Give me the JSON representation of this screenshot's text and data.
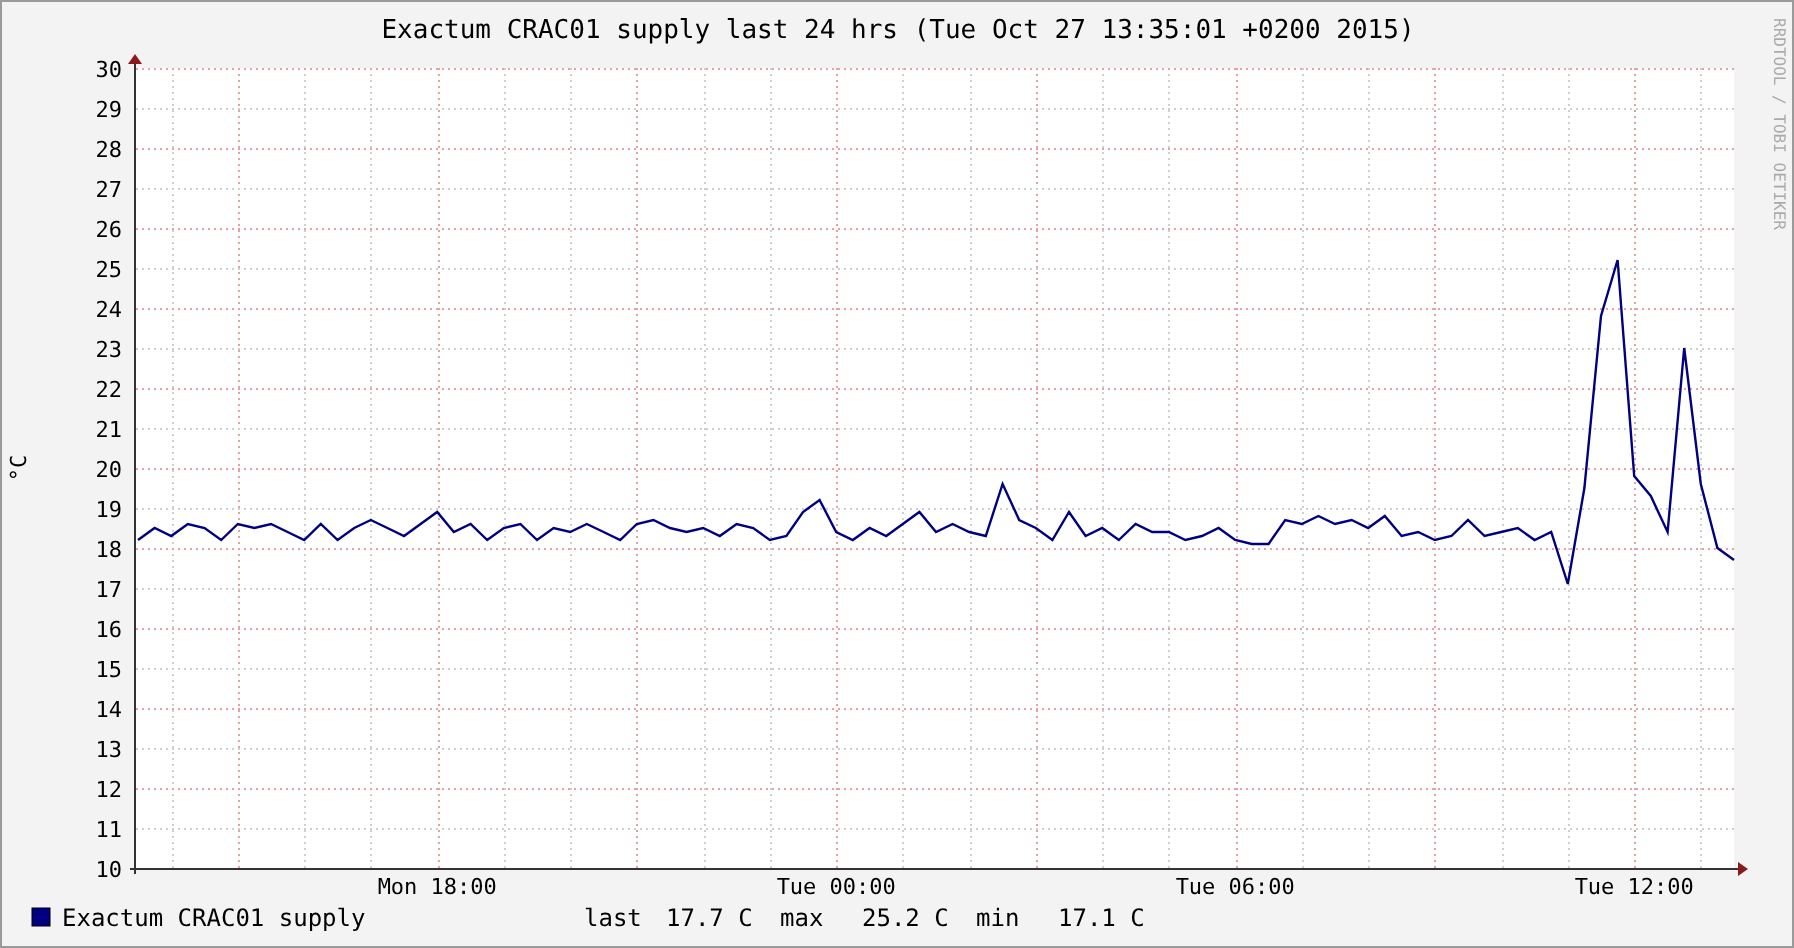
{
  "graph": {
    "chart_data": {
      "type": "line",
      "title": "Exactum CRAC01 supply last 24 hrs (Tue Oct 27 13:35:01 +0200 2015)",
      "ylabel": "°C",
      "categories": [
        null,
        null,
        null,
        null,
        null,
        null,
        null,
        null,
        null,
        null,
        null,
        null,
        null,
        null,
        null,
        null,
        null,
        null,
        "Mon 18:00",
        null,
        null,
        null,
        null,
        null,
        null,
        null,
        null,
        null,
        null,
        null,
        null,
        null,
        null,
        null,
        null,
        null,
        null,
        null,
        null,
        null,
        null,
        null,
        "Tue 00:00",
        null,
        null,
        null,
        null,
        null,
        null,
        null,
        null,
        null,
        null,
        null,
        null,
        null,
        null,
        null,
        null,
        null,
        null,
        null,
        null,
        null,
        null,
        null,
        "Tue 06:00",
        null,
        null,
        null,
        null,
        null,
        null,
        null,
        null,
        null,
        null,
        null,
        null,
        null,
        null,
        null,
        null,
        null,
        null,
        null,
        null,
        null,
        null,
        null,
        "Tue 12:00",
        null,
        null,
        null,
        null,
        null,
        null
      ],
      "series": [
        {
          "name": "Exactum CRAC01 supply",
          "color": "#000080",
          "values": [
            18.2,
            18.5,
            18.3,
            18.6,
            18.5,
            18.2,
            18.6,
            18.5,
            18.6,
            18.4,
            18.2,
            18.6,
            18.2,
            18.5,
            18.7,
            18.5,
            18.3,
            18.6,
            18.9,
            18.4,
            18.6,
            18.2,
            18.5,
            18.6,
            18.2,
            18.5,
            18.4,
            18.6,
            18.4,
            18.2,
            18.6,
            18.7,
            18.5,
            18.4,
            18.5,
            18.3,
            18.6,
            18.5,
            18.2,
            18.3,
            18.9,
            19.2,
            18.4,
            18.2,
            18.5,
            18.3,
            18.6,
            18.9,
            18.4,
            18.6,
            18.4,
            18.3,
            19.6,
            18.7,
            18.5,
            18.2,
            18.9,
            18.3,
            18.5,
            18.2,
            18.6,
            18.4,
            18.4,
            18.2,
            18.3,
            18.5,
            18.2,
            18.1,
            18.1,
            18.7,
            18.6,
            18.8,
            18.6,
            18.7,
            18.5,
            18.8,
            18.3,
            18.4,
            18.2,
            18.3,
            18.7,
            18.3,
            18.4,
            18.5,
            18.2,
            18.4,
            17.1,
            19.5,
            23.8,
            25.2,
            19.8,
            19.3,
            18.4,
            23.0,
            19.6,
            18.0,
            17.7
          ]
        }
      ],
      "grid": true,
      "ylim": [
        10,
        30
      ],
      "yticks": [
        10,
        11,
        12,
        13,
        14,
        15,
        16,
        17,
        18,
        19,
        20,
        21,
        22,
        23,
        24,
        25,
        26,
        27,
        28,
        29,
        30
      ]
    },
    "stats": [
      {
        "name": "last",
        "value": "17.7 C"
      },
      {
        "name": "max",
        "value": "25.2 C"
      },
      {
        "name": "min",
        "value": "17.1 C"
      }
    ],
    "credit": "RRDTOOL / TOBI OETIKER"
  }
}
